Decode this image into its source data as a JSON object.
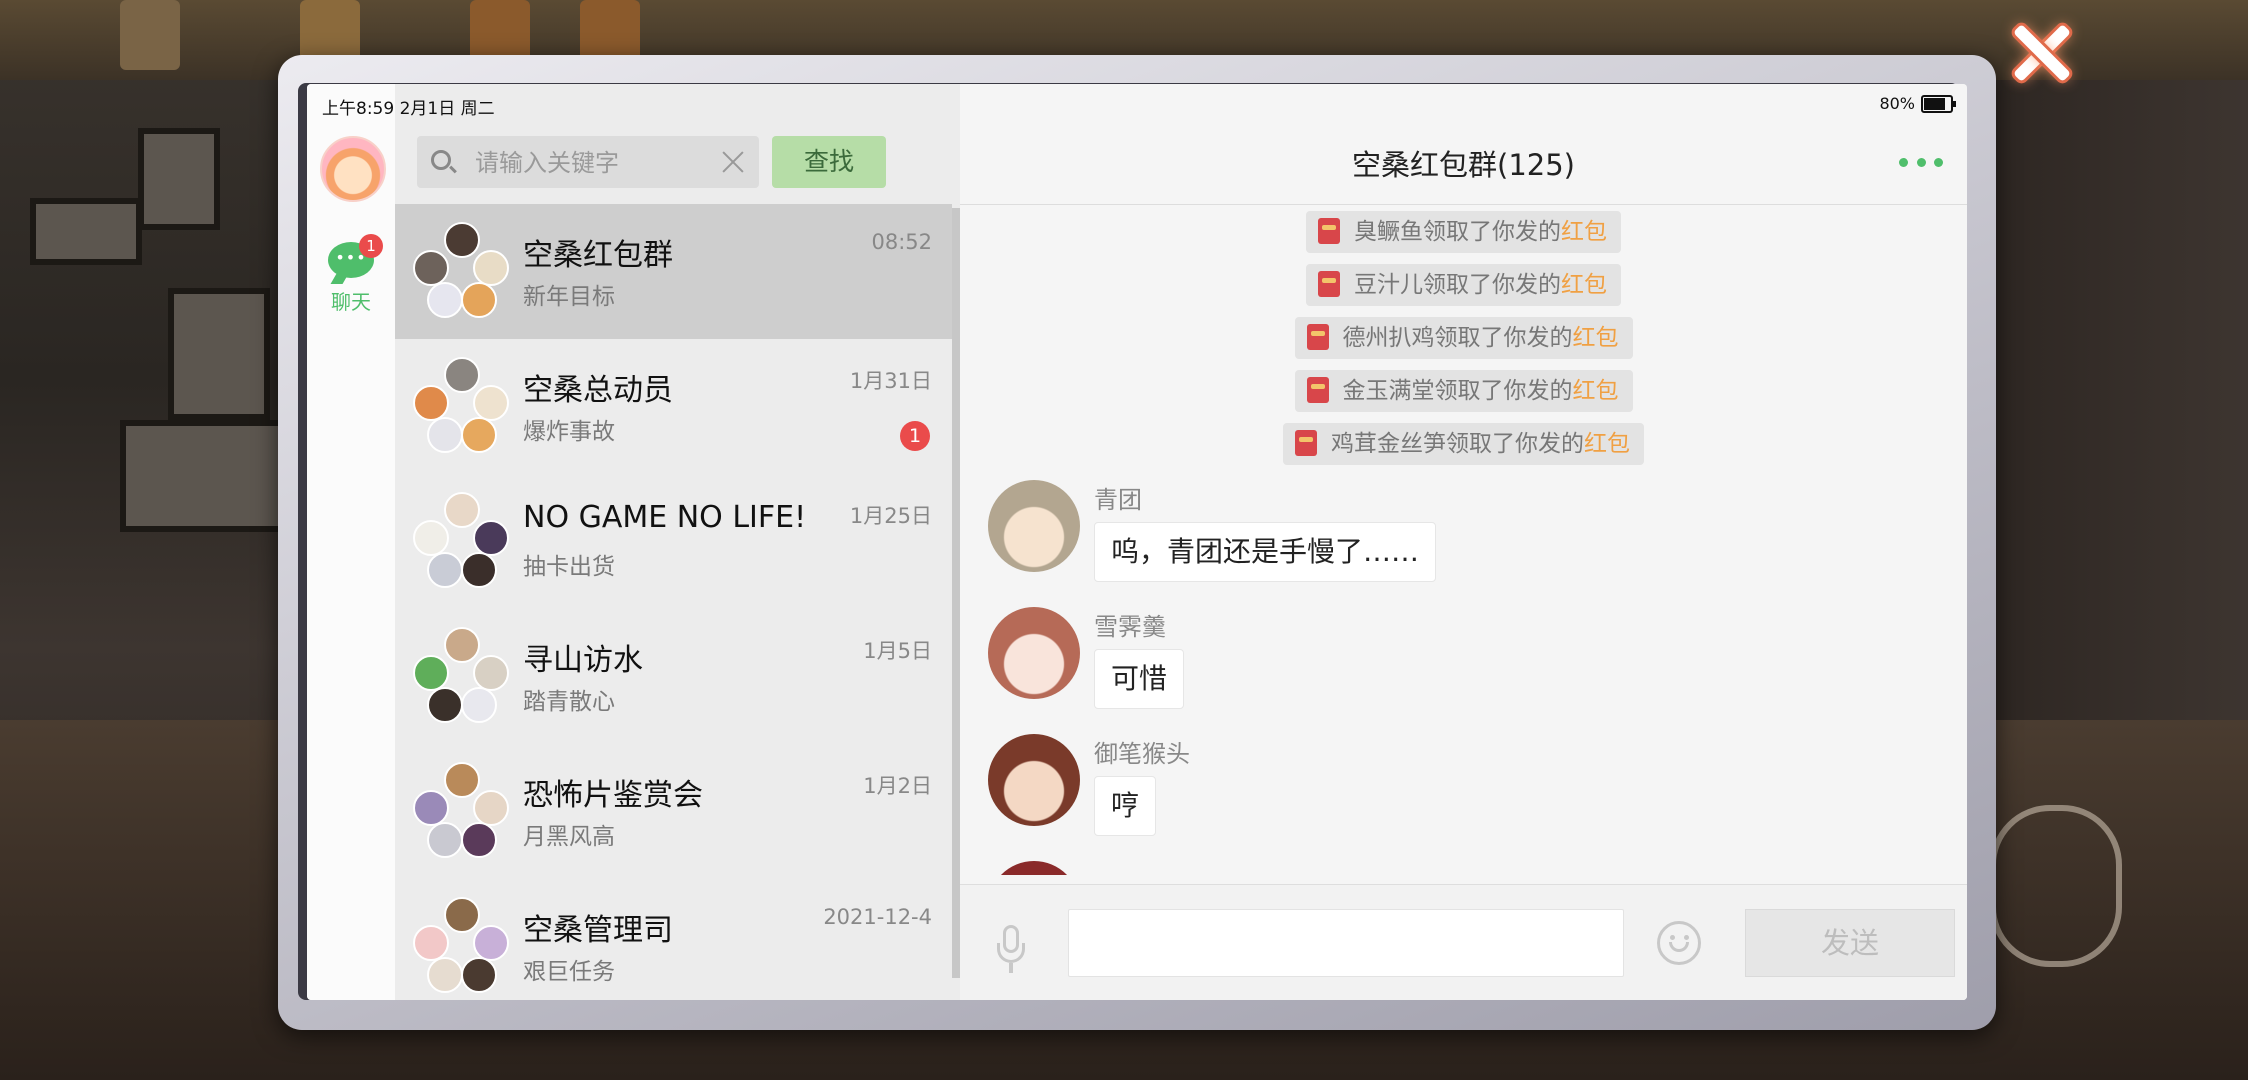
{
  "status": {
    "time": "上午8:59  2月1日 周二",
    "battery": "80%"
  },
  "nav": {
    "chat_label": "聊天",
    "chat_badge": "1"
  },
  "search": {
    "placeholder": "请输入关键字",
    "button": "查找"
  },
  "conversations": [
    {
      "name": "空桑红包群",
      "message": "新年目标",
      "time": "08:52",
      "badge": "",
      "active": true
    },
    {
      "name": "空桑总动员",
      "message": "爆炸事故",
      "time": "1月31日",
      "badge": "1",
      "active": false
    },
    {
      "name": "NO GAME NO LIFE!",
      "message": "抽卡出货",
      "time": "1月25日",
      "badge": "",
      "active": false
    },
    {
      "name": "寻山访水",
      "message": "踏青散心",
      "time": "1月5日",
      "badge": "",
      "active": false
    },
    {
      "name": "恐怖片鉴赏会",
      "message": "月黑风高",
      "time": "1月2日",
      "badge": "",
      "active": false
    },
    {
      "name": "空桑管理司",
      "message": "艰巨任务",
      "time": "2021-12-4",
      "badge": "",
      "active": false
    }
  ],
  "chat": {
    "title": "空桑红包群(125)",
    "system_messages": [
      {
        "text": "臭鳜鱼领取了你发的",
        "highlight": "红包"
      },
      {
        "text": "豆汁儿领取了你发的",
        "highlight": "红包"
      },
      {
        "text": "德州扒鸡领取了你发的",
        "highlight": "红包"
      },
      {
        "text": "金玉满堂领取了你发的",
        "highlight": "红包"
      },
      {
        "text": "鸡茸金丝笋领取了你发的",
        "highlight": "红包"
      }
    ],
    "messages": [
      {
        "sender": "青团",
        "text": "呜，青团还是手慢了……"
      },
      {
        "sender": "雪霁羹",
        "text": "可惜"
      },
      {
        "sender": "御笔猴头",
        "text": "哼"
      }
    ],
    "send_label": "发送"
  },
  "colors": {
    "accent": "#4fbe6b",
    "highlight": "#f0a043",
    "badge": "#ea4b4b"
  }
}
